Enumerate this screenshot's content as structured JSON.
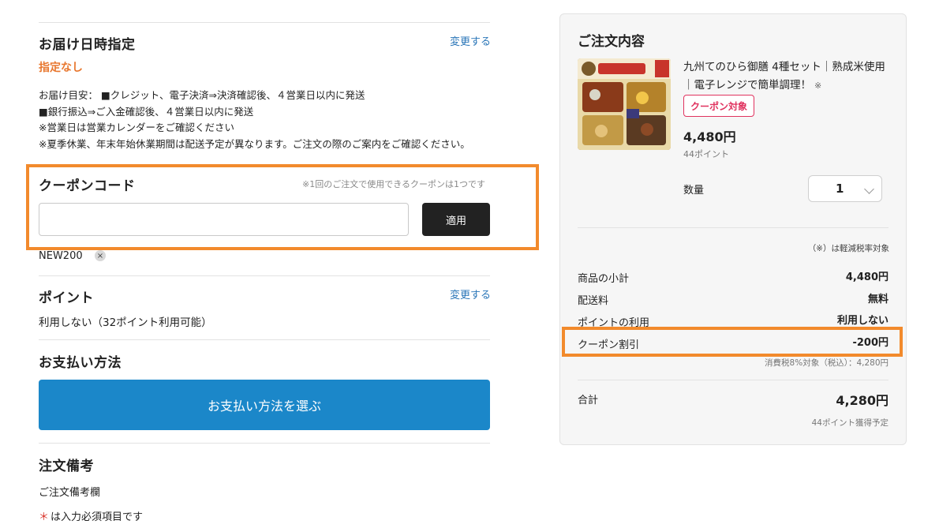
{
  "delivery": {
    "title": "お届け日時指定",
    "change_label": "変更する",
    "selected": "指定なし",
    "notes": [
      "お届け目安： ■クレジット、電子決済⇒決済確認後、４営業日以内に発送",
      "■銀行振込⇒ご入金確認後、４営業日以内に発送",
      "※営業日は営業カレンダーをご確認ください",
      "※夏季休業、年末年始休業期間は配送予定が異なります。ご注文の際のご案内をご確認ください。"
    ]
  },
  "coupon": {
    "title": "クーポンコード",
    "note": "※1回のご注文で使用できるクーポンは1つです",
    "input_value": "",
    "input_placeholder": "",
    "apply_label": "適用",
    "applied_code": "NEW200",
    "remove_icon": "×",
    "highlight_color": "#f28a2c"
  },
  "points": {
    "title": "ポイント",
    "change_label": "変更する",
    "status": "利用しない（32ポイント利用可能）"
  },
  "payment": {
    "title": "お支払い方法",
    "button_label": "お支払い方法を選ぶ",
    "button_color": "#1b87c9"
  },
  "remarks": {
    "title": "注文備考",
    "field_label": "ご注文備考欄",
    "required_star": "＊",
    "required_note": "は入力必須項目です"
  },
  "order_summary": {
    "title": "ご注文内容",
    "product": {
      "name": "九州てのひら御膳 4種セット｜熟成米使用｜電子レンジで簡単調理！",
      "name_suffix": "※",
      "badge": "クーポン対象",
      "price": "4,480円",
      "points": "44ポイント",
      "qty_label": "数量",
      "qty_value": "1",
      "thumb_icons": [
        "food-bento-image"
      ]
    },
    "tax_note": "（※）は軽減税率対象",
    "rows": [
      {
        "label": "商品の小計",
        "value": "4,480円"
      },
      {
        "label": "配送料",
        "value": "無料"
      },
      {
        "label": "ポイントの利用",
        "value": "利用しない"
      },
      {
        "label": "クーポン割引",
        "value": "-200円"
      }
    ],
    "tax_detail": "消費税8%対象（税込）：4,280円",
    "total_label": "合計",
    "total_value": "4,280円",
    "earn_points": "44ポイント獲得予定"
  }
}
